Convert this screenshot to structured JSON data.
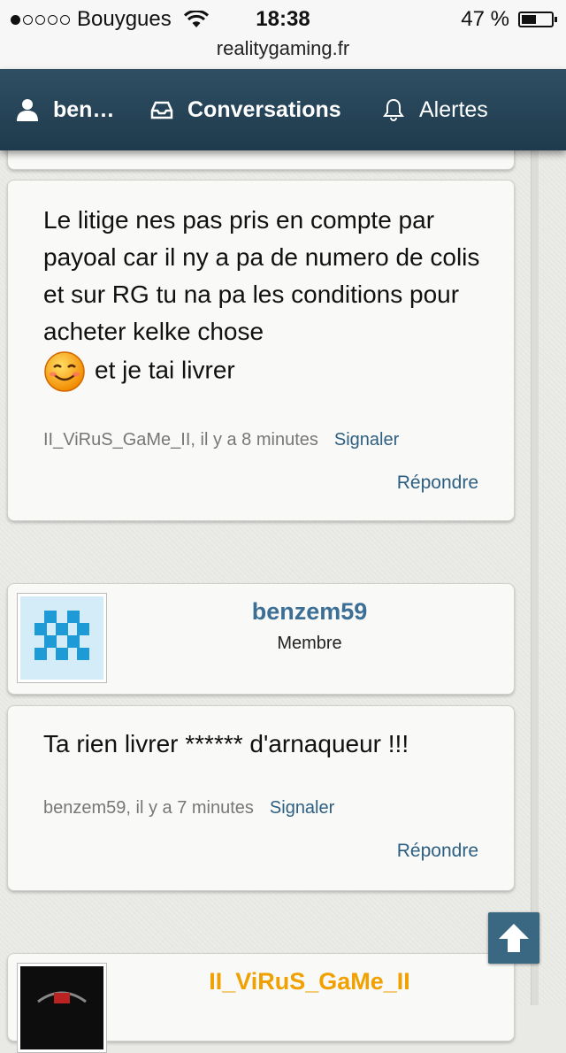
{
  "status_bar": {
    "carrier": "Bouygues",
    "time": "18:38",
    "battery_percent": "47 %",
    "battery_level": 0.47,
    "signal_bars_filled": 1,
    "signal_bars_total": 5,
    "url": "realitygaming.fr"
  },
  "nav": {
    "user_label": "ben…",
    "conversations_label": "Conversations",
    "alerts_label": "Alertes",
    "user_icon": "user-icon",
    "conversations_icon": "inbox-icon",
    "alerts_icon": "bell-icon",
    "background_color": "#24445a"
  },
  "posts": [
    {
      "text_before_smiley": "Le litige nes pas pris en compte par payoal car il ny a pa de numero de colis et sur RG tu na pa les conditions pour acheter kelke chose",
      "smiley_icon": "smiley-icon",
      "text_after_smiley": "et je tai livrer",
      "author_time": "II_ViRuS_GaMe_II, il y a 8 minutes",
      "report_label": "Signaler",
      "reply_label": "Répondre"
    },
    {
      "username": "benzem59",
      "user_title": "Membre",
      "text": "Ta rien livrer ****** d'arnaqueur !!!",
      "author_time": "benzem59, il y a 7 minutes",
      "report_label": "Signaler",
      "reply_label": "Répondre"
    },
    {
      "username": "II_ViRuS_GaMe_II"
    }
  ],
  "colors": {
    "link": "#2d5f82",
    "username_member": "#3b6f95",
    "username_highlight": "#f0a000",
    "scroll_button": "#3a6782"
  },
  "scroll_top_icon": "arrow-up-icon"
}
